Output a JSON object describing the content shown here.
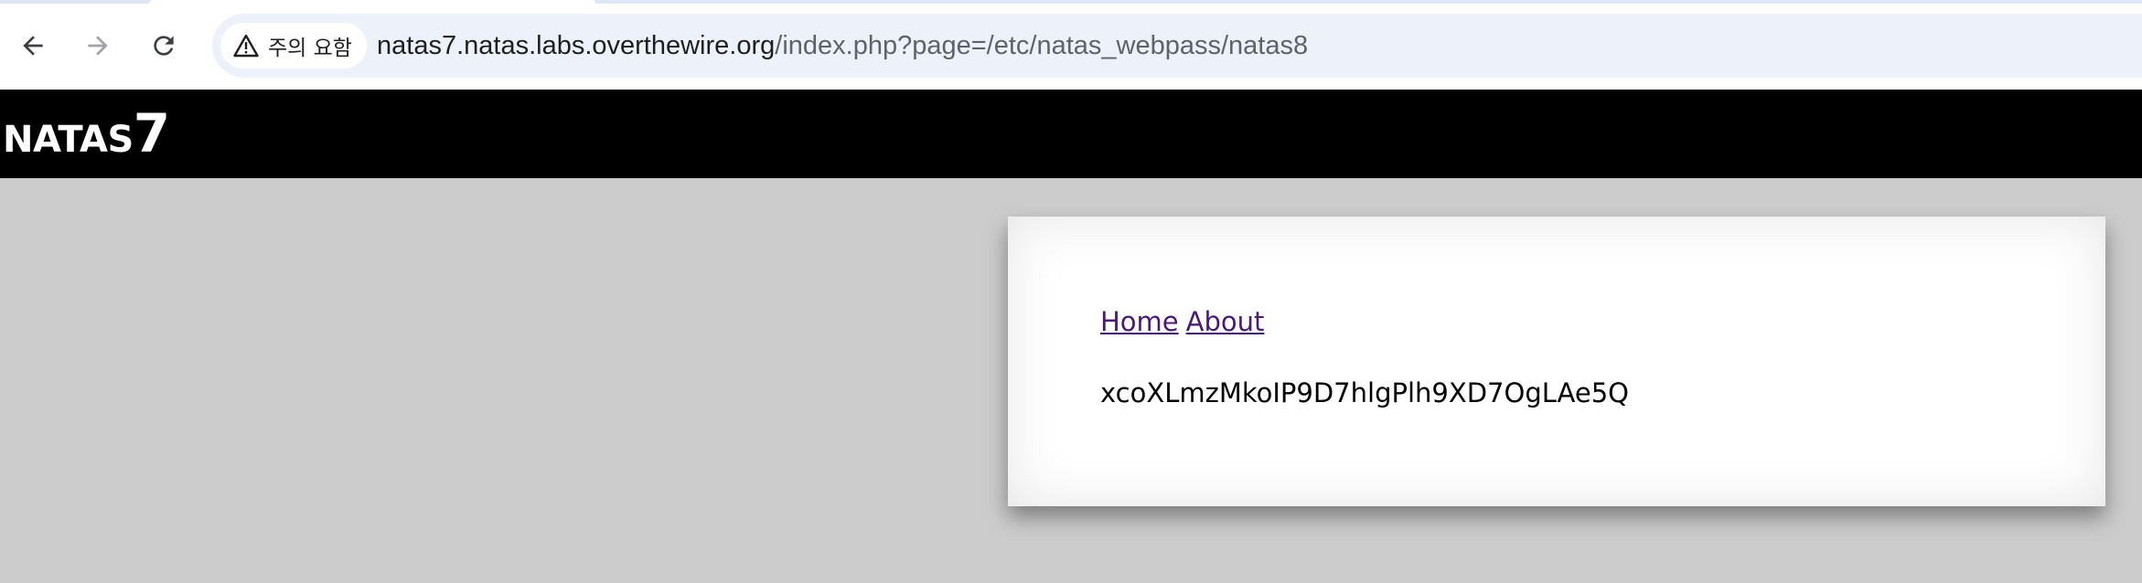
{
  "browser": {
    "security_label": "주의 요함",
    "url_host": "natas7.natas.labs.overthewire.org",
    "url_path": "/index.php?page=/etc/natas_webpass/natas8",
    "icons": {
      "back": "arrow-left-icon",
      "forward": "arrow-right-icon",
      "reload": "reload-icon",
      "security": "warning-icon"
    }
  },
  "header": {
    "title_word": "NATAS",
    "title_level": "7"
  },
  "content": {
    "links": {
      "home": "Home",
      "about": "About"
    },
    "password": "xcoXLmzMkoIP9D7hlgPlh9XD7OgLAe5Q"
  },
  "colors": {
    "page_background": "#cccccc",
    "header_background": "#000000",
    "link_color": "#4b1a78"
  }
}
